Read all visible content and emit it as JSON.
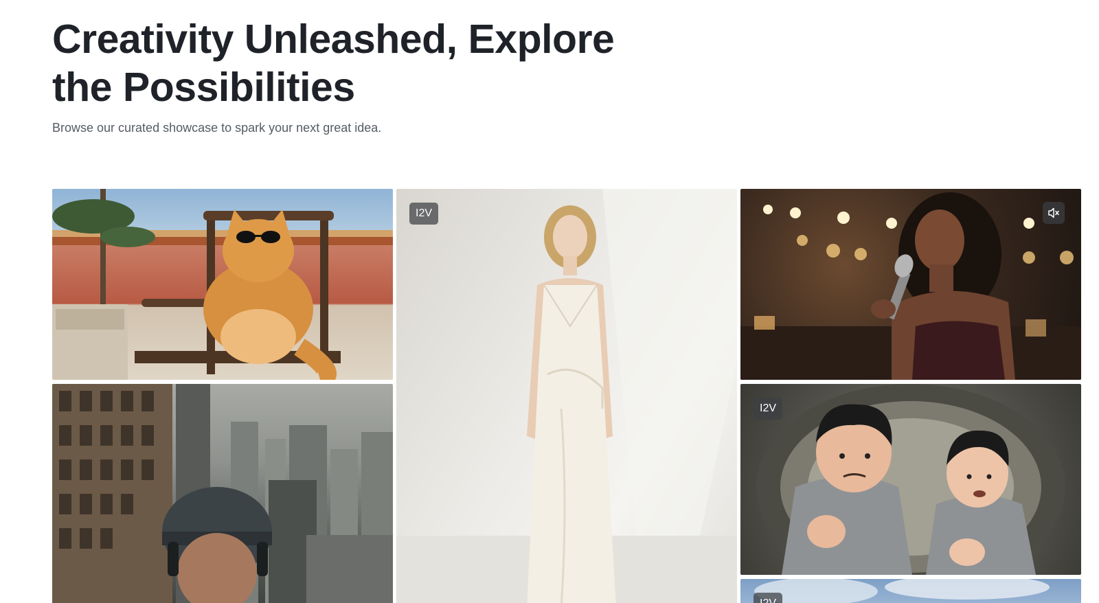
{
  "hero": {
    "title_line1": "Creativity Unleashed, Explore",
    "title_line2": "the Possibilities",
    "subtitle": "Browse our curated showcase to spark your next great idea."
  },
  "gallery": {
    "cards": [
      {
        "subject": "orange cat in sunglasses on wooden chair",
        "badge": ""
      },
      {
        "subject": "woman in white satin dress",
        "badge": "I2V"
      },
      {
        "subject": "woman singing into microphone",
        "badge": "",
        "mute_icon": "speaker-muted-icon"
      },
      {
        "subject": "man in helmet above city",
        "badge": ""
      },
      {
        "subject": "two cartoon men peering through pipe",
        "badge": "I2V"
      },
      {
        "subject": "sky scene",
        "badge": "I2V"
      }
    ]
  }
}
